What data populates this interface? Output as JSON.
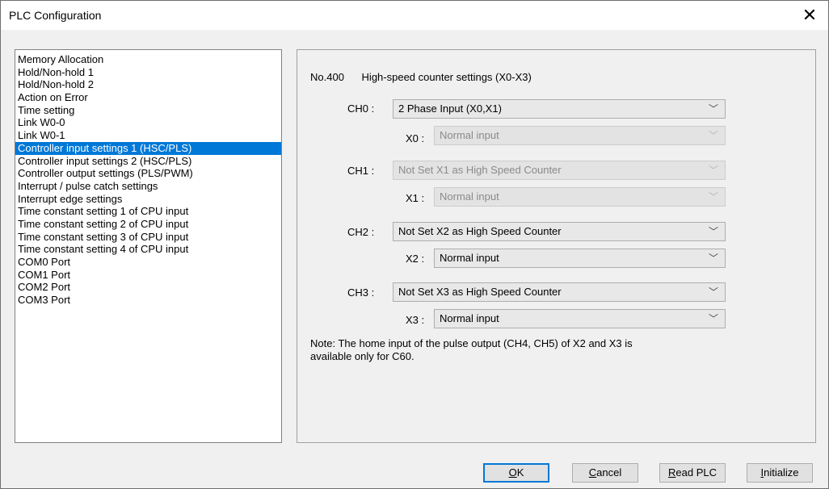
{
  "window": {
    "title": "PLC Configuration",
    "close_glyph": "✕"
  },
  "nav": {
    "items": [
      "Memory Allocation",
      "Hold/Non-hold 1",
      "Hold/Non-hold 2",
      "Action on Error",
      "Time setting",
      "Link W0-0",
      "Link W0-1",
      "Controller input settings 1 (HSC/PLS)",
      "Controller input settings 2 (HSC/PLS)",
      "Controller output settings (PLS/PWM)",
      "Interrupt / pulse catch settings",
      "Interrupt edge settings",
      "Time constant setting 1 of CPU input",
      "Time constant setting 2 of CPU input",
      "Time constant setting 3 of CPU input",
      "Time constant setting 4 of CPU input",
      "COM0 Port",
      "COM1 Port",
      "COM2 Port",
      "COM3 Port"
    ],
    "selected_index": 7
  },
  "panel": {
    "number": "No.400",
    "heading": "High-speed counter settings (X0-X3)",
    "ch0": {
      "label": "CH0 :",
      "value": "2 Phase Input (X0,X1)"
    },
    "x0": {
      "label": "X0 :",
      "value": "Normal input"
    },
    "ch1": {
      "label": "CH1 :",
      "value": "Not Set X1 as High Speed Counter"
    },
    "x1": {
      "label": "X1 :",
      "value": "Normal input"
    },
    "ch2": {
      "label": "CH2 :",
      "value": "Not Set X2 as High Speed Counter"
    },
    "x2": {
      "label": "X2 :",
      "value": "Normal input"
    },
    "ch3": {
      "label": "CH3 :",
      "value": "Not Set X3 as High Speed Counter"
    },
    "x3": {
      "label": "X3 :",
      "value": "Normal input"
    },
    "note_line1": "Note: The home input of the pulse output (CH4, CH5) of X2 and X3 is",
    "note_line2": "available only for C60.",
    "dropdown_glyph": "﹀"
  },
  "buttons": {
    "ok": {
      "mnemonic": "O",
      "rest": "K"
    },
    "cancel": {
      "mnemonic": "C",
      "rest": "ancel"
    },
    "read_plc": {
      "mnemonic": "R",
      "rest": "ead PLC"
    },
    "initialize": {
      "mnemonic": "I",
      "rest": "nitialize"
    }
  }
}
